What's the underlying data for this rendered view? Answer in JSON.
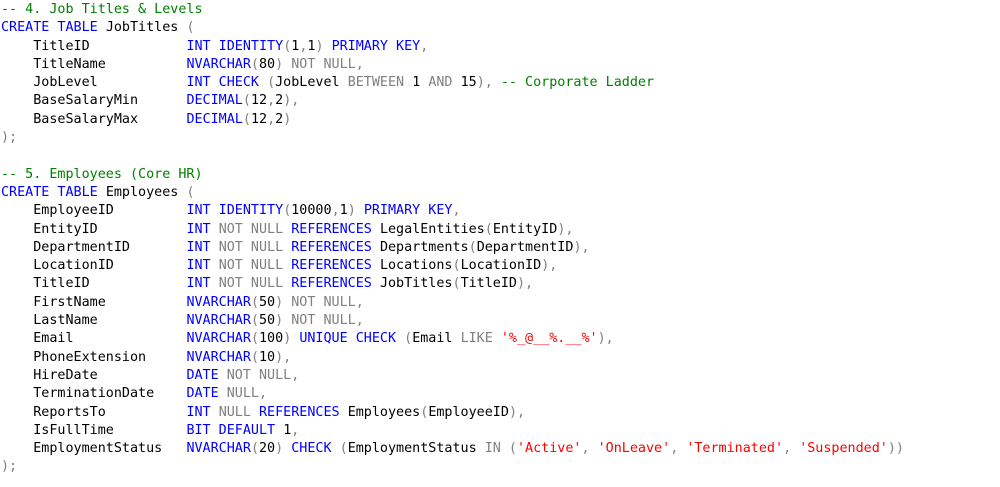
{
  "editor": {
    "colors": {
      "keyword": "#0000ff",
      "identifier": "#000000",
      "gray": "#808080",
      "string": "#ff0000",
      "comment": "#008000",
      "background": "#ffffff"
    },
    "lines": [
      [
        [
          "cm",
          "-- 4. Job Titles & Levels"
        ]
      ],
      [
        [
          "kw",
          "CREATE TABLE "
        ],
        [
          "id",
          "JobTitles "
        ],
        [
          "gr",
          "("
        ]
      ],
      [
        [
          "id",
          "    TitleID            "
        ],
        [
          "kw",
          "INT IDENTITY"
        ],
        [
          "gr",
          "("
        ],
        [
          "id",
          "1"
        ],
        [
          "gr",
          ","
        ],
        [
          "id",
          "1"
        ],
        [
          "gr",
          ") "
        ],
        [
          "kw",
          "PRIMARY KEY"
        ],
        [
          "gr",
          ","
        ]
      ],
      [
        [
          "id",
          "    TitleName          "
        ],
        [
          "kw",
          "NVARCHAR"
        ],
        [
          "gr",
          "("
        ],
        [
          "id",
          "80"
        ],
        [
          "gr",
          ") NOT NULL,"
        ]
      ],
      [
        [
          "id",
          "    JobLevel           "
        ],
        [
          "kw",
          "INT CHECK "
        ],
        [
          "gr",
          "("
        ],
        [
          "id",
          "JobLevel "
        ],
        [
          "gr",
          "BETWEEN "
        ],
        [
          "id",
          "1 "
        ],
        [
          "gr",
          "AND "
        ],
        [
          "id",
          "15"
        ],
        [
          "gr",
          "), "
        ],
        [
          "cm",
          "-- Corporate Ladder"
        ]
      ],
      [
        [
          "id",
          "    BaseSalaryMin      "
        ],
        [
          "kw",
          "DECIMAL"
        ],
        [
          "gr",
          "("
        ],
        [
          "id",
          "12"
        ],
        [
          "gr",
          ","
        ],
        [
          "id",
          "2"
        ],
        [
          "gr",
          "),"
        ]
      ],
      [
        [
          "id",
          "    BaseSalaryMax      "
        ],
        [
          "kw",
          "DECIMAL"
        ],
        [
          "gr",
          "("
        ],
        [
          "id",
          "12"
        ],
        [
          "gr",
          ","
        ],
        [
          "id",
          "2"
        ],
        [
          "gr",
          ")"
        ]
      ],
      [
        [
          "gr",
          ");"
        ]
      ],
      [],
      [
        [
          "cm",
          "-- 5. Employees (Core HR)"
        ]
      ],
      [
        [
          "kw",
          "CREATE TABLE "
        ],
        [
          "id",
          "Employees "
        ],
        [
          "gr",
          "("
        ]
      ],
      [
        [
          "id",
          "    EmployeeID         "
        ],
        [
          "kw",
          "INT IDENTITY"
        ],
        [
          "gr",
          "("
        ],
        [
          "id",
          "10000"
        ],
        [
          "gr",
          ","
        ],
        [
          "id",
          "1"
        ],
        [
          "gr",
          ") "
        ],
        [
          "kw",
          "PRIMARY KEY"
        ],
        [
          "gr",
          ","
        ]
      ],
      [
        [
          "id",
          "    EntityID           "
        ],
        [
          "kw",
          "INT "
        ],
        [
          "gr",
          "NOT NULL "
        ],
        [
          "kw",
          "REFERENCES "
        ],
        [
          "id",
          "LegalEntities"
        ],
        [
          "gr",
          "("
        ],
        [
          "id",
          "EntityID"
        ],
        [
          "gr",
          "),"
        ]
      ],
      [
        [
          "id",
          "    DepartmentID       "
        ],
        [
          "kw",
          "INT "
        ],
        [
          "gr",
          "NOT NULL "
        ],
        [
          "kw",
          "REFERENCES "
        ],
        [
          "id",
          "Departments"
        ],
        [
          "gr",
          "("
        ],
        [
          "id",
          "DepartmentID"
        ],
        [
          "gr",
          "),"
        ]
      ],
      [
        [
          "id",
          "    LocationID         "
        ],
        [
          "kw",
          "INT "
        ],
        [
          "gr",
          "NOT NULL "
        ],
        [
          "kw",
          "REFERENCES "
        ],
        [
          "id",
          "Locations"
        ],
        [
          "gr",
          "("
        ],
        [
          "id",
          "LocationID"
        ],
        [
          "gr",
          "),"
        ]
      ],
      [
        [
          "id",
          "    TitleID            "
        ],
        [
          "kw",
          "INT "
        ],
        [
          "gr",
          "NOT NULL "
        ],
        [
          "kw",
          "REFERENCES "
        ],
        [
          "id",
          "JobTitles"
        ],
        [
          "gr",
          "("
        ],
        [
          "id",
          "TitleID"
        ],
        [
          "gr",
          "),"
        ]
      ],
      [
        [
          "id",
          "    FirstName          "
        ],
        [
          "kw",
          "NVARCHAR"
        ],
        [
          "gr",
          "("
        ],
        [
          "id",
          "50"
        ],
        [
          "gr",
          ") NOT NULL,"
        ]
      ],
      [
        [
          "id",
          "    LastName           "
        ],
        [
          "kw",
          "NVARCHAR"
        ],
        [
          "gr",
          "("
        ],
        [
          "id",
          "50"
        ],
        [
          "gr",
          ") NOT NULL,"
        ]
      ],
      [
        [
          "id",
          "    Email              "
        ],
        [
          "kw",
          "NVARCHAR"
        ],
        [
          "gr",
          "("
        ],
        [
          "id",
          "100"
        ],
        [
          "gr",
          ") "
        ],
        [
          "kw",
          "UNIQUE CHECK "
        ],
        [
          "gr",
          "("
        ],
        [
          "id",
          "Email "
        ],
        [
          "gr",
          "LIKE "
        ],
        [
          "str",
          "'%_@__%.__%'"
        ],
        [
          "gr",
          "),"
        ]
      ],
      [
        [
          "id",
          "    PhoneExtension     "
        ],
        [
          "kw",
          "NVARCHAR"
        ],
        [
          "gr",
          "("
        ],
        [
          "id",
          "10"
        ],
        [
          "gr",
          "),"
        ]
      ],
      [
        [
          "id",
          "    HireDate           "
        ],
        [
          "kw",
          "DATE "
        ],
        [
          "gr",
          "NOT NULL,"
        ]
      ],
      [
        [
          "id",
          "    TerminationDate    "
        ],
        [
          "kw",
          "DATE "
        ],
        [
          "gr",
          "NULL,"
        ]
      ],
      [
        [
          "id",
          "    ReportsTo          "
        ],
        [
          "kw",
          "INT "
        ],
        [
          "gr",
          "NULL "
        ],
        [
          "kw",
          "REFERENCES "
        ],
        [
          "id",
          "Employees"
        ],
        [
          "gr",
          "("
        ],
        [
          "id",
          "EmployeeID"
        ],
        [
          "gr",
          "),"
        ]
      ],
      [
        [
          "id",
          "    IsFullTime         "
        ],
        [
          "kw",
          "BIT DEFAULT "
        ],
        [
          "id",
          "1"
        ],
        [
          "gr",
          ","
        ]
      ],
      [
        [
          "id",
          "    EmploymentStatus   "
        ],
        [
          "kw",
          "NVARCHAR"
        ],
        [
          "gr",
          "("
        ],
        [
          "id",
          "20"
        ],
        [
          "gr",
          ") "
        ],
        [
          "kw",
          "CHECK "
        ],
        [
          "gr",
          "("
        ],
        [
          "id",
          "EmploymentStatus "
        ],
        [
          "gr",
          "IN ("
        ],
        [
          "str",
          "'Active'"
        ],
        [
          "gr",
          ", "
        ],
        [
          "str",
          "'OnLeave'"
        ],
        [
          "gr",
          ", "
        ],
        [
          "str",
          "'Terminated'"
        ],
        [
          "gr",
          ", "
        ],
        [
          "str",
          "'Suspended'"
        ],
        [
          "gr",
          "))"
        ]
      ],
      [
        [
          "gr",
          ");"
        ]
      ]
    ]
  }
}
